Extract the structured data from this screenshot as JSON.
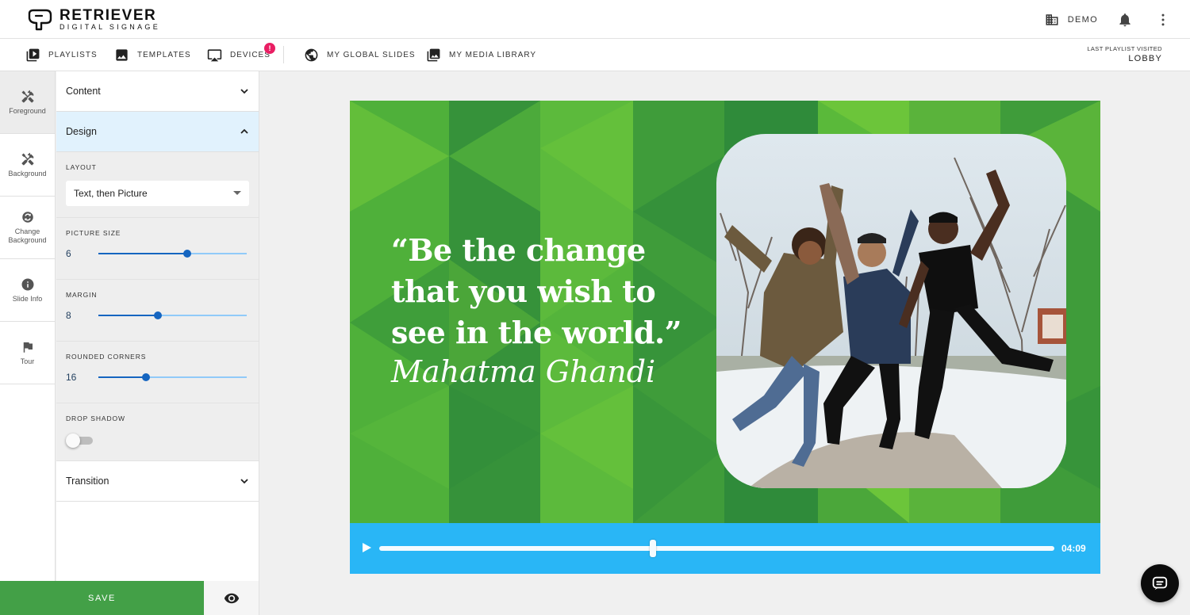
{
  "brand": {
    "name": "RETRIEVER",
    "tagline": "DIGITAL SIGNAGE"
  },
  "header": {
    "org_label": "DEMO"
  },
  "nav": {
    "items": [
      {
        "label": "PLAYLISTS",
        "icon": "playlist-play-icon"
      },
      {
        "label": "TEMPLATES",
        "icon": "image-icon"
      },
      {
        "label": "DEVICES",
        "icon": "cast-icon",
        "badge": "!"
      },
      {
        "label": "MY GLOBAL SLIDES",
        "icon": "globe-icon"
      },
      {
        "label": "MY MEDIA LIBRARY",
        "icon": "photo-library-icon"
      }
    ],
    "last_visited_label": "LAST PLAYLIST VISITED",
    "last_visited_value": "LOBBY"
  },
  "rail": {
    "items": [
      {
        "label": "Foreground",
        "icon": "tools-icon",
        "active": true
      },
      {
        "label": "Background",
        "icon": "tools-icon",
        "active": false
      },
      {
        "label": "Change Background",
        "icon": "change-background-icon",
        "active": false
      },
      {
        "label": "Slide Info",
        "icon": "info-icon",
        "active": false
      },
      {
        "label": "Tour",
        "icon": "flag-icon",
        "active": false
      }
    ]
  },
  "panel": {
    "content_label": "Content",
    "design_label": "Design",
    "transition_label": "Transition",
    "layout": {
      "label": "LAYOUT",
      "value": "Text, then Picture"
    },
    "picture_size": {
      "label": "PICTURE SIZE",
      "value": "6",
      "fraction": 0.6
    },
    "margin": {
      "label": "MARGIN",
      "value": "8",
      "fraction": 0.4
    },
    "rounded_corners": {
      "label": "ROUNDED CORNERS",
      "value": "16",
      "fraction": 0.32
    },
    "drop_shadow": {
      "label": "DROP SHADOW",
      "enabled": false
    }
  },
  "actions": {
    "save_label": "SAVE"
  },
  "slide": {
    "quote": "“Be the change that you wish to see in the world.”",
    "author": "Mahatma Ghandi"
  },
  "player": {
    "time": "04:09",
    "progress": 0.405
  },
  "colors": {
    "slide_green": "#6cc53a",
    "player_blue": "#29b6f6",
    "save_green": "#43a047",
    "slider_blue": "#1565c0",
    "badge_pink": "#e91e63"
  }
}
